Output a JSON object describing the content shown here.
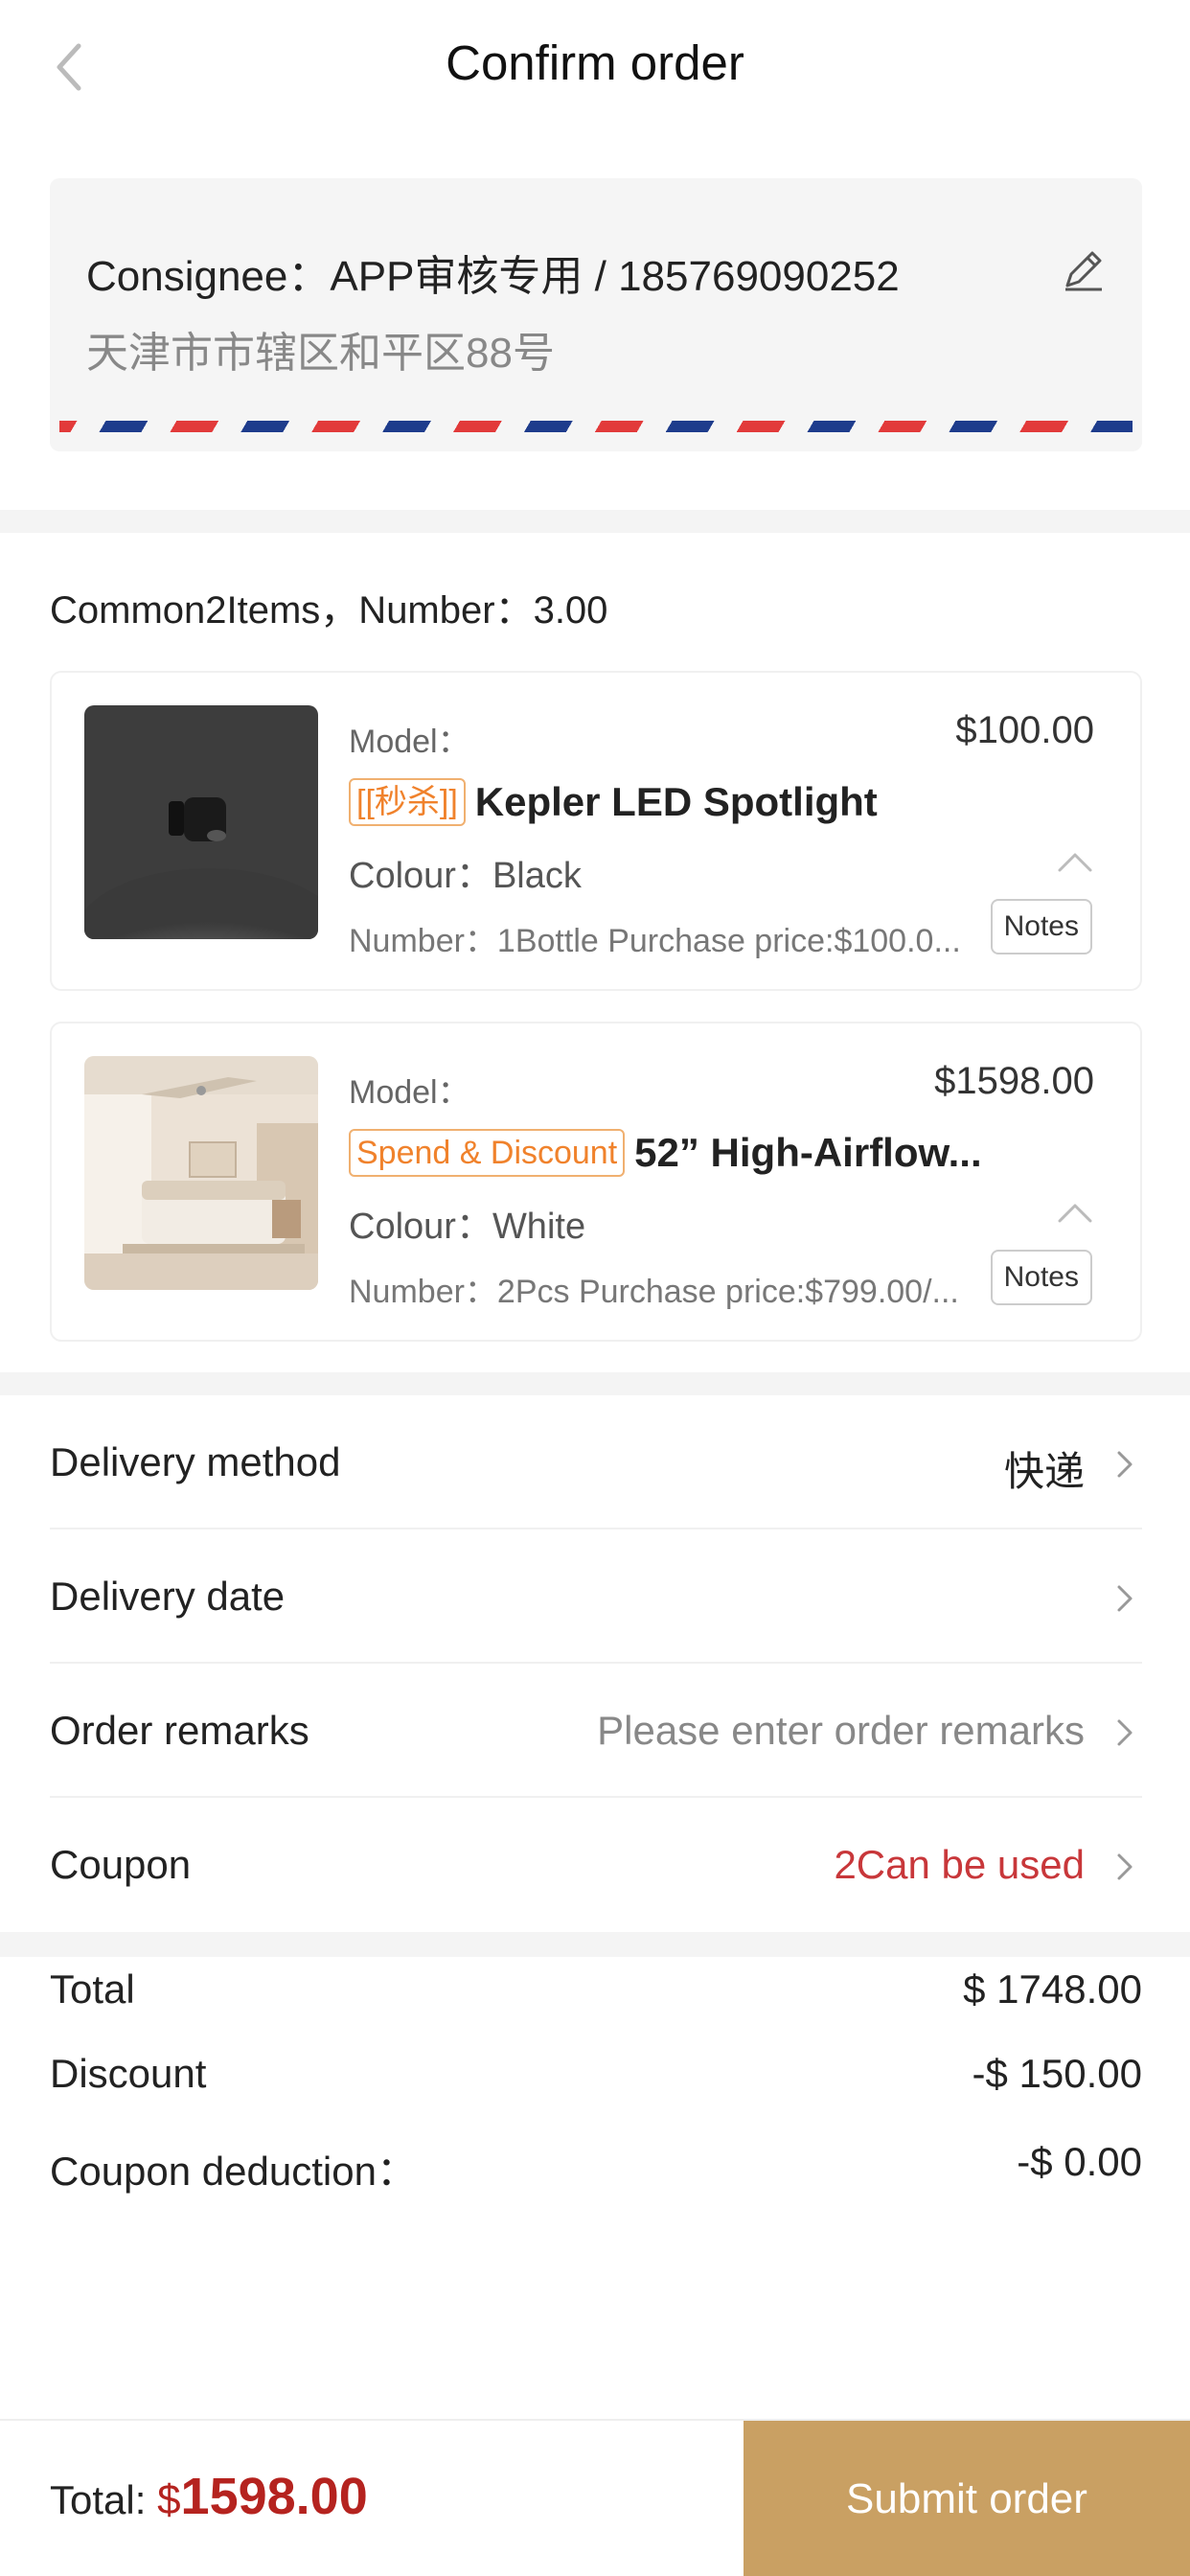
{
  "header": {
    "title": "Confirm order"
  },
  "address": {
    "consignee": "Consignee：APP审核专用 / 185769090252",
    "address": "天津市市辖区和平区88号"
  },
  "items_summary": "Common2Items，Number：3.00",
  "products": [
    {
      "model_label": "Model：",
      "price": "$100.00",
      "tag": "[[秒杀]]",
      "name": "Kepler LED Spotlight",
      "colour": "Colour：Black",
      "number": "Number：1Bottle Purchase price:$100.0...",
      "notes_label": "Notes"
    },
    {
      "model_label": "Model：",
      "price": "$1598.00",
      "tag": "Spend & Discount",
      "name": "52” High-Airflow...",
      "colour": "Colour：White",
      "number": "Number：2Pcs Purchase price:$799.00/...",
      "notes_label": "Notes"
    }
  ],
  "options": [
    {
      "label": "Delivery method",
      "value": "快递"
    },
    {
      "label": "Delivery date",
      "value": ""
    },
    {
      "label": "Order remarks",
      "value": "Please enter order remarks"
    },
    {
      "label": "Coupon",
      "value": "2Can be used"
    }
  ],
  "summary": [
    {
      "label": "Total",
      "value": "$ 1748.00"
    },
    {
      "label": "Discount",
      "value": "-$ 150.00"
    },
    {
      "label": "Coupon deduction：",
      "value": "-$ 0.00"
    }
  ],
  "footer": {
    "total_label": "Total: ",
    "currency": "$",
    "amount": "1598.00",
    "submit_label": "Submit order"
  },
  "colors": {
    "accent_price": "#b5231f",
    "coupon_text": "#c8373a",
    "submit_button": "#c9a063",
    "promo_tag": "#f0822c"
  }
}
